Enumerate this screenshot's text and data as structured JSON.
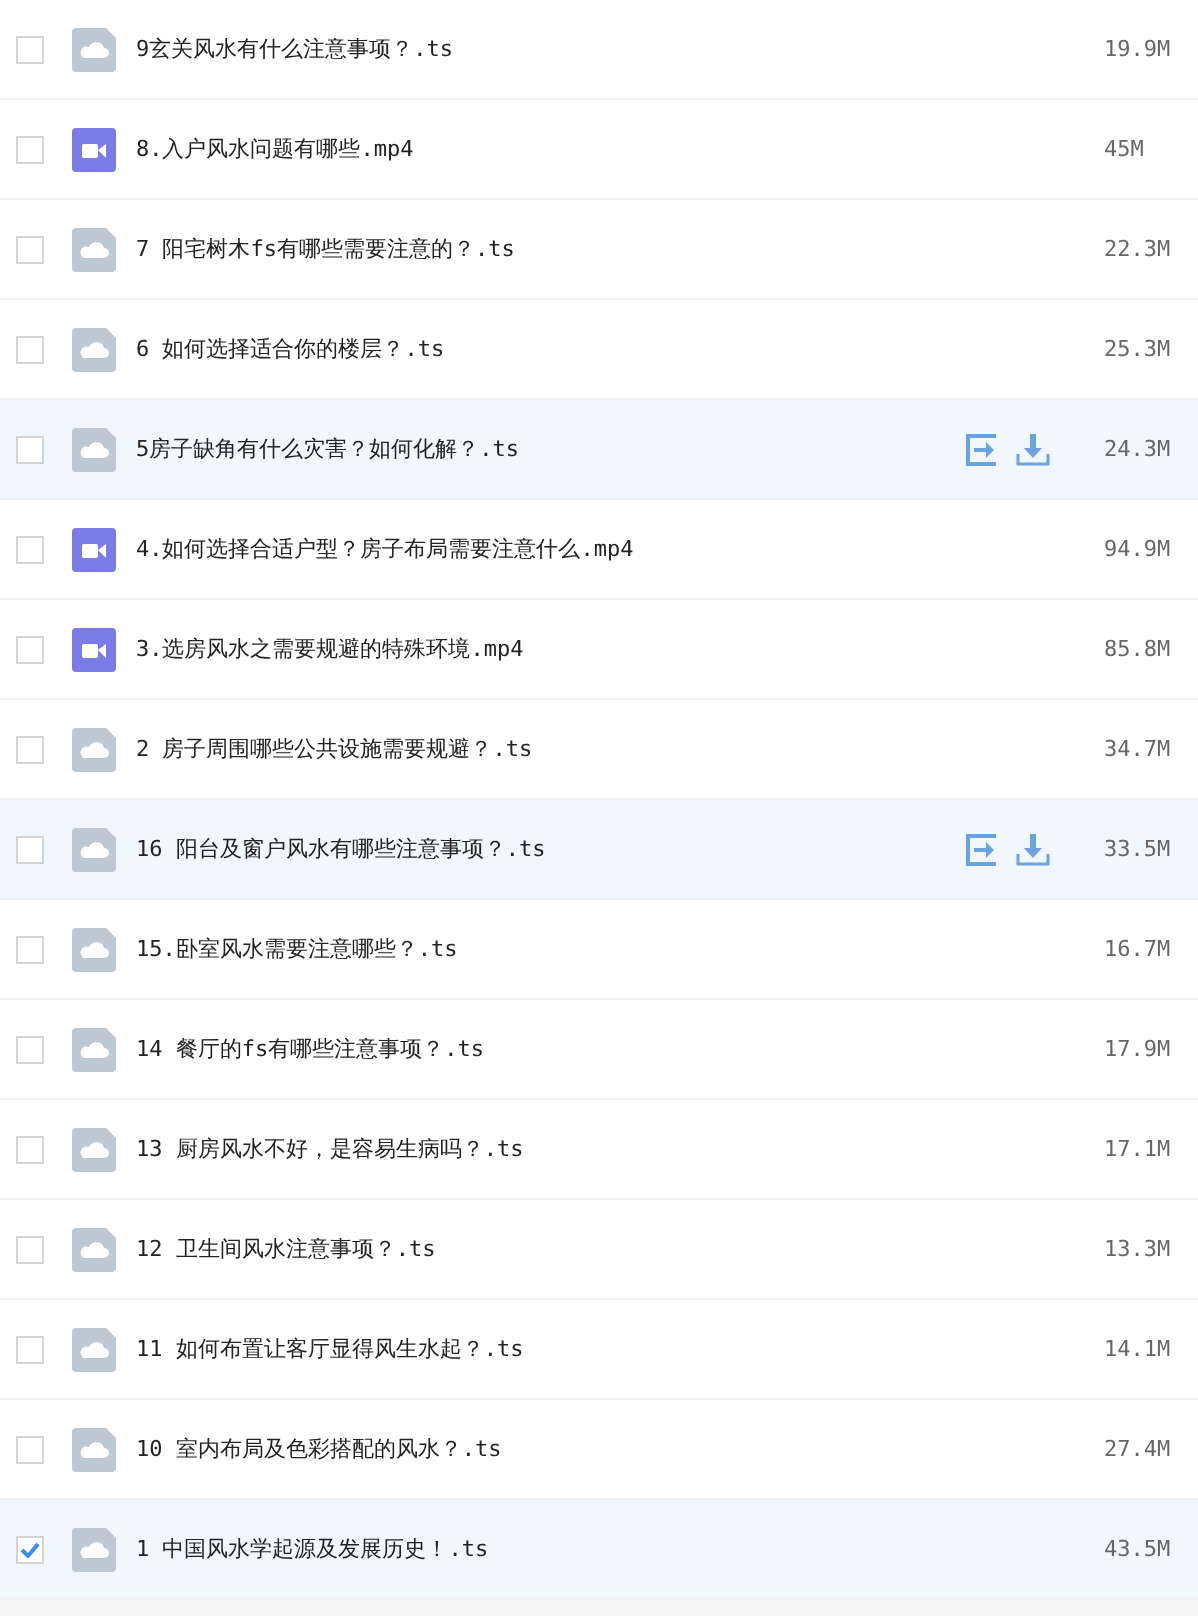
{
  "files": [
    {
      "name": "9玄关风水有什么注意事项？.ts",
      "kind": "ts",
      "size": "19.9M",
      "checked": false,
      "hovered": false
    },
    {
      "name": "8.入户风水问题有哪些.mp4",
      "kind": "mp4",
      "size": "45M",
      "checked": false,
      "hovered": false
    },
    {
      "name": "7 阳宅树木fs有哪些需要注意的？.ts",
      "kind": "ts",
      "size": "22.3M",
      "checked": false,
      "hovered": false
    },
    {
      "name": "6 如何选择适合你的楼层？.ts",
      "kind": "ts",
      "size": "25.3M",
      "checked": false,
      "hovered": false
    },
    {
      "name": "5房子缺角有什么灾害？如何化解？.ts",
      "kind": "ts",
      "size": "24.3M",
      "checked": false,
      "hovered": true
    },
    {
      "name": "4.如何选择合适户型？房子布局需要注意什么.mp4",
      "kind": "mp4",
      "size": "94.9M",
      "checked": false,
      "hovered": false
    },
    {
      "name": "3.选房风水之需要规避的特殊环境.mp4",
      "kind": "mp4",
      "size": "85.8M",
      "checked": false,
      "hovered": false
    },
    {
      "name": "2 房子周围哪些公共设施需要规避？.ts",
      "kind": "ts",
      "size": "34.7M",
      "checked": false,
      "hovered": false
    },
    {
      "name": "16 阳台及窗户风水有哪些注意事项？.ts",
      "kind": "ts",
      "size": "33.5M",
      "checked": false,
      "hovered": true
    },
    {
      "name": "15.卧室风水需要注意哪些？.ts",
      "kind": "ts",
      "size": "16.7M",
      "checked": false,
      "hovered": false
    },
    {
      "name": "14 餐厅的fs有哪些注意事项？.ts",
      "kind": "ts",
      "size": "17.9M",
      "checked": false,
      "hovered": false
    },
    {
      "name": "13 厨房风水不好，是容易生病吗？.ts",
      "kind": "ts",
      "size": "17.1M",
      "checked": false,
      "hovered": false
    },
    {
      "name": "12 卫生间风水注意事项？.ts",
      "kind": "ts",
      "size": "13.3M",
      "checked": false,
      "hovered": false
    },
    {
      "name": "11 如何布置让客厅显得风生水起？.ts",
      "kind": "ts",
      "size": "14.1M",
      "checked": false,
      "hovered": false
    },
    {
      "name": "10 室内布局及色彩搭配的风水？.ts",
      "kind": "ts",
      "size": "27.4M",
      "checked": false,
      "hovered": false
    },
    {
      "name": "1 中国风水学起源及发展历史！.ts",
      "kind": "ts",
      "size": "43.5M",
      "checked": true,
      "hovered": false
    }
  ]
}
